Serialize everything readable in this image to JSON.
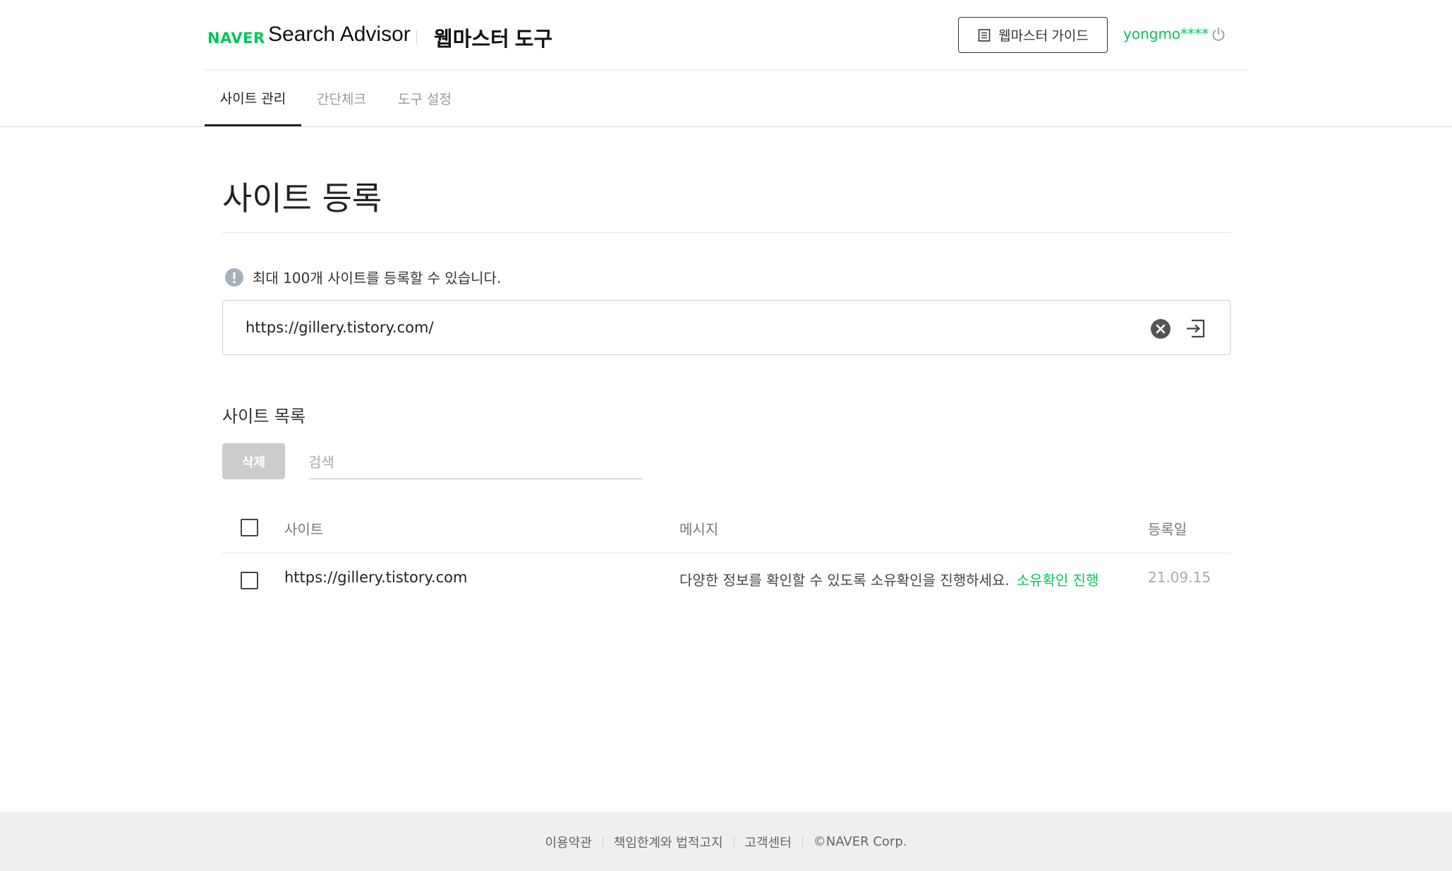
{
  "header": {
    "logo": "NAVER",
    "brand": "Search Advisor",
    "subtitle": "웹마스터 도구",
    "guide_label": "웹마스터 가이드",
    "user": "yongmo****",
    "accent_color": "#03c75a"
  },
  "tabs": [
    {
      "label": "사이트 관리",
      "active": true
    },
    {
      "label": "간단체크",
      "active": false
    },
    {
      "label": "도구 설정",
      "active": false
    }
  ],
  "main": {
    "title": "사이트 등록",
    "notice": "최대 100개 사이트를 등록할 수 있습니다.",
    "url_value": "https://gillery.tistory.com/",
    "icons": {
      "notice": "info-icon",
      "clear": "clear-icon",
      "submit": "submit-icon"
    }
  },
  "list": {
    "title": "사이트 목록",
    "delete_label": "삭제",
    "search_placeholder": "검색",
    "columns": {
      "site": "사이트",
      "message": "메시지",
      "date": "등록일"
    },
    "rows": [
      {
        "site": "https://gillery.tistory.com",
        "message": "다양한 정보를 확인할 수 있도록 소유확인을 진행하세요.",
        "action": "소유확인 진행",
        "date": "21.09.15"
      }
    ]
  },
  "footer": {
    "links": [
      "이용약관",
      "책임한계와 법적고지",
      "고객센터"
    ],
    "copyright": "©NAVER Corp."
  }
}
